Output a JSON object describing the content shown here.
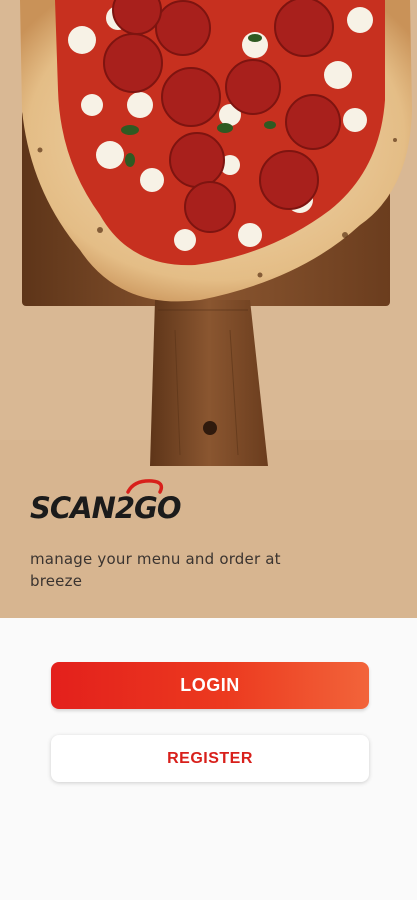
{
  "hero": {
    "image_icon": "pepperoni-pizza-on-wooden-board",
    "colors": {
      "paper": "#d8b592",
      "board": "#7a4a2a",
      "crust": "#e9c99a",
      "sauce": "#c62c22",
      "pepperoni": "#b0231f",
      "cheese": "#f7f2e8"
    }
  },
  "brand": {
    "logo_text": "SCAN2GO",
    "tagline": "manage your menu and order at breeze"
  },
  "actions": {
    "login_label": "LOGIN",
    "register_label": "REGISTER",
    "accent_color": "#e3201c"
  }
}
